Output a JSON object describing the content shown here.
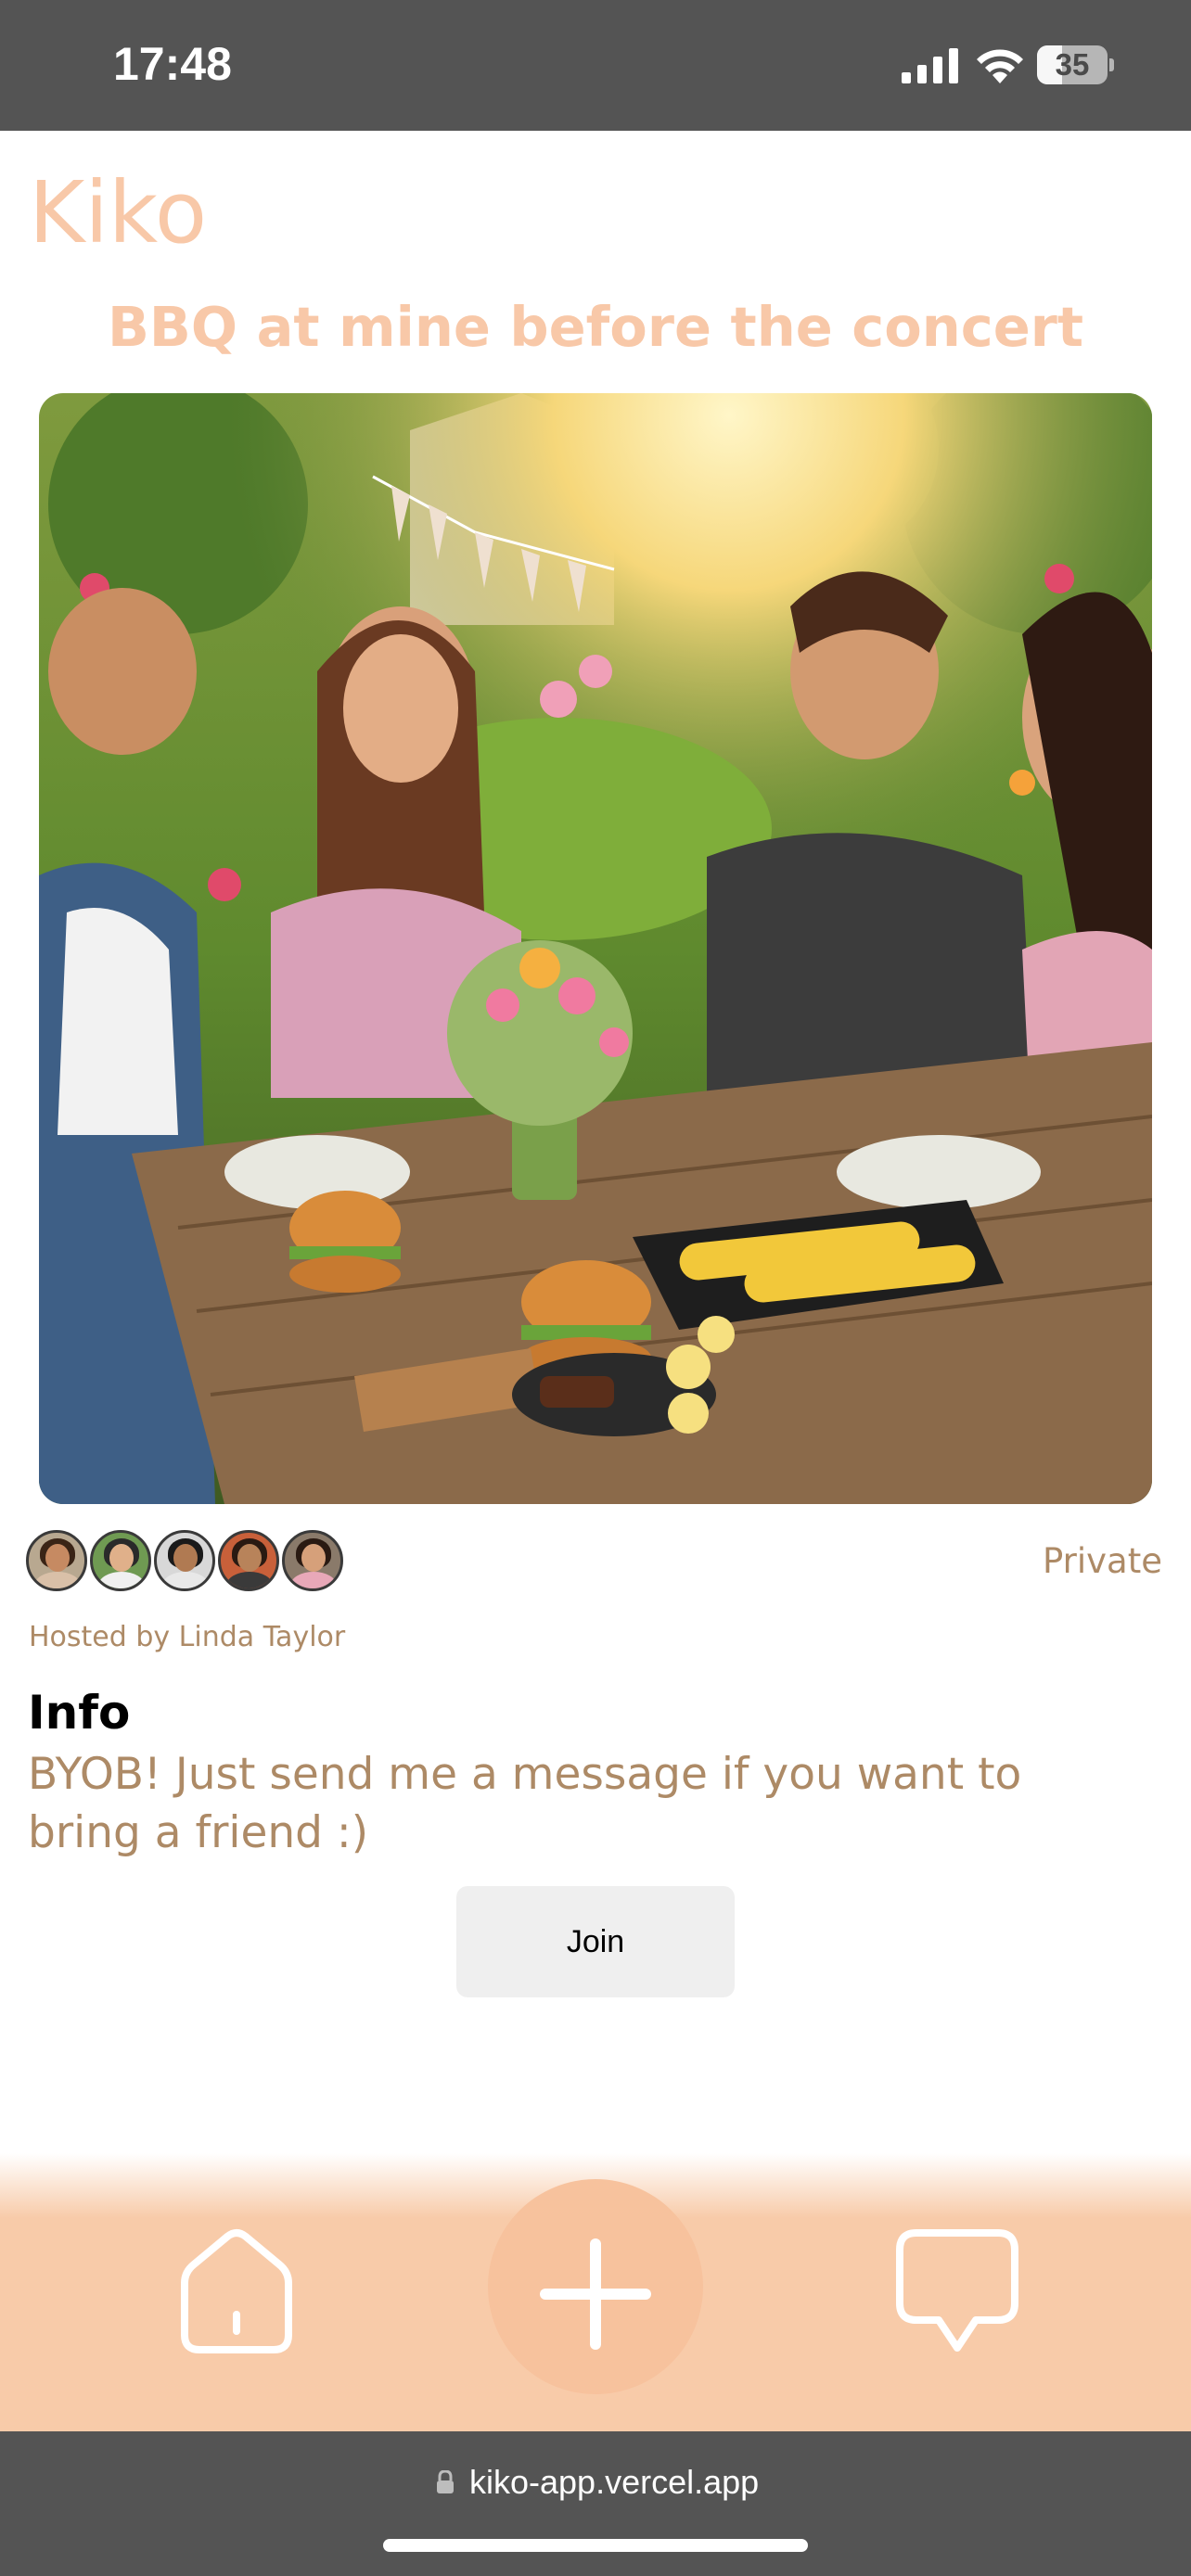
{
  "status_bar": {
    "time": "17:48",
    "battery_level": "35",
    "battery_fraction": 0.35
  },
  "app": {
    "logo": "Kiko"
  },
  "event": {
    "title": "BBQ at mine before the concert",
    "privacy": "Private",
    "host": "Hosted by Linda Taylor",
    "info_heading": "Info",
    "info_text": "BYOB! Just send me a message if you want to bring a friend :)",
    "join_label": "Join",
    "attendee_count": 5
  },
  "nav": {
    "items": [
      "home-icon",
      "plus-icon",
      "chat-bubble-icon"
    ]
  },
  "browser": {
    "url": "kiko-app.vercel.app"
  },
  "colors": {
    "brand_peach": "#f8c8a8",
    "text_tan": "#ad8a66",
    "nav_background": "#f8cba9",
    "system_bar": "#545454"
  }
}
